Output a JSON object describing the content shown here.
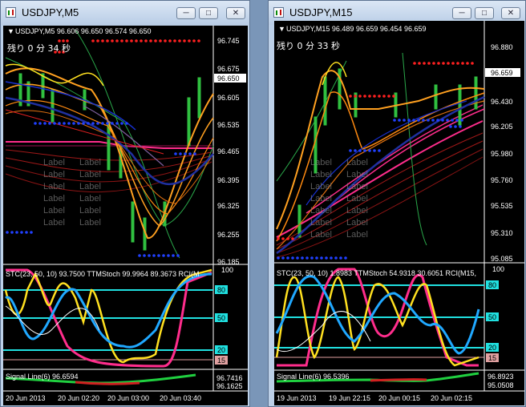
{
  "windows": [
    {
      "title": "USDJPY,M5",
      "header": "USDJPY,M5  96.606 96.650 96.574 96.650",
      "countdown": "残り 0 分 34 秒",
      "price_axis": [
        "96.745",
        "96.675",
        "96.650",
        "96.605",
        "96.535",
        "96.465",
        "96.395",
        "96.325",
        "96.255",
        "96.185"
      ],
      "current_price": "96.650",
      "ghost_label": "Label",
      "osc_header": "STC(23, 50, 10) 93.7500  TTMStoch 99.9964 89.3673  RCI(M",
      "osc_top": "100",
      "osc_levels": [
        "80",
        "50",
        "20",
        "15"
      ],
      "signal_header": "Signal Line(6) 96.6594",
      "signal_axis": [
        "96.7416",
        "96.1625"
      ],
      "time_axis": [
        "20 Jun 2013",
        "20 Jun 02:20",
        "20 Jun 03:00",
        "20 Jun 03:40"
      ]
    },
    {
      "title": "USDJPY,M15",
      "header": "USDJPY,M15  96.489 96.659 96.454 96.659",
      "countdown": "残り 0 分 33 秒",
      "price_axis": [
        "96.880",
        "96.659",
        "96.430",
        "96.205",
        "95.980",
        "95.760",
        "95.535",
        "95.310",
        "95.085"
      ],
      "current_price": "96.659",
      "ghost_label": "Label",
      "osc_header": "STC(23, 50, 10) 1.8983  TTMStoch 54.9318 30.6051  RCI(M15,",
      "osc_top": "100",
      "osc_levels": [
        "80",
        "50",
        "20",
        "15"
      ],
      "signal_header": "Signal Line(6) 96.5396",
      "signal_axis": [
        "96.8923",
        "95.0508"
      ],
      "time_axis": [
        "19 Jun 2013",
        "19 Jun 22:15",
        "20 Jun 00:15",
        "20 Jun 02:15"
      ]
    }
  ],
  "controls": {
    "minimize": "─",
    "maximize": "□",
    "close": "✕"
  },
  "colors": {
    "accent_orange": "#ffa020",
    "band_magenta": "#ff2d8c",
    "band_red": "#cc2020",
    "blue_dots": "#2040ff",
    "red_dots": "#ff2020",
    "cyan_level": "#20e0e0",
    "stoch_yellow": "#ffe020",
    "rci_blue": "#20a8ff"
  }
}
